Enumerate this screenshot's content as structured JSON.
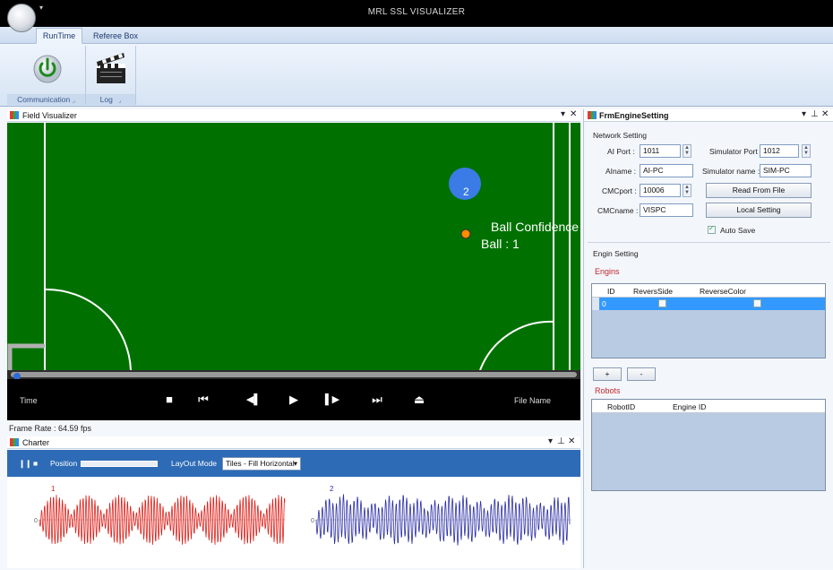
{
  "app": {
    "title": "MRL SSL VISUALIZER"
  },
  "ribbon": {
    "tabs": [
      {
        "label": "RunTime"
      },
      {
        "label": "Referee Box"
      }
    ],
    "groups": [
      {
        "label": "Communication"
      },
      {
        "label": "Log"
      }
    ]
  },
  "field_visualizer": {
    "title": "Field Visualizer",
    "robot_id": "2",
    "ball_confidence_text": "Ball Confidence",
    "ball_text": "Ball : 1",
    "colors": {
      "field": "#007100",
      "robot": "#3a7be6",
      "ball": "#ff8c00",
      "lines": "#ffffff"
    }
  },
  "playbar": {
    "time_label": "Time",
    "file_name_label": "File Name",
    "buttons": [
      {
        "icon": "stop-icon",
        "glyph": "■"
      },
      {
        "icon": "skip-start-icon",
        "glyph": "⏮"
      },
      {
        "icon": "step-back-icon",
        "glyph": "◀▌"
      },
      {
        "icon": "play-icon",
        "glyph": "▶"
      },
      {
        "icon": "step-forward-icon",
        "glyph": "▌▶"
      },
      {
        "icon": "skip-end-icon",
        "glyph": "⏭"
      },
      {
        "icon": "eject-icon",
        "glyph": "⏏"
      }
    ]
  },
  "status": {
    "frame_rate": "Frame Rate : 64.59  fps"
  },
  "charter": {
    "title": "Charter",
    "position_label": "Position",
    "layout_mode_label": "LayOut Mode",
    "layout_mode_value": "Tiles - Fill Horizontal",
    "chart1_label": "1",
    "chart2_label": "2",
    "zero_label": "0",
    "colors": {
      "series1": "#e0201a",
      "series2": "#2b2fa6",
      "toolbar": "#2e6bb6"
    }
  },
  "engine_setting": {
    "title": "FrmEngineSetting",
    "network_setting_label": "Network Setting",
    "ai_port_label": "AI Port :",
    "ai_port_value": "1011",
    "ainame_label": "AIname :",
    "ainame_value": "AI-PC",
    "cmcport_label": "CMCport :",
    "cmcport_value": "10006",
    "cmcname_label": "CMCname :",
    "cmcname_value": "VISPC",
    "simulator_port_label": "Simulator Port :",
    "simulator_port_value": "1012",
    "simulator_name_label": "Simulator name :",
    "simulator_name_value": "SIM-PC",
    "read_from_file_label": "Read From File",
    "local_setting_label": "Local Setting",
    "auto_save_label": "Auto Save",
    "engin_setting_label": "Engin Setting",
    "engins_section": "Engins",
    "engins_columns": [
      "ID",
      "ReversSide",
      "ReverseColor"
    ],
    "engins_rows": [
      {
        "id": "0"
      }
    ],
    "add_button_label": "+",
    "remove_button_label": "-",
    "robots_section": "Robots",
    "robots_columns": [
      "RobotID",
      "Engine ID"
    ]
  }
}
